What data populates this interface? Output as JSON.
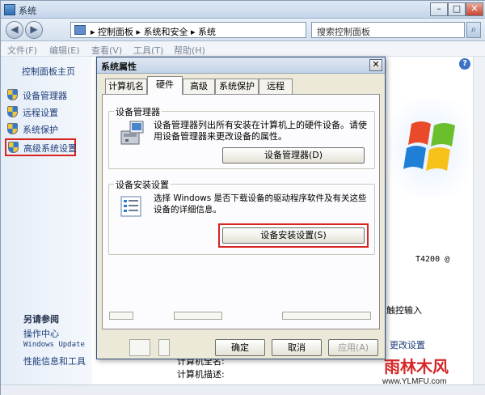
{
  "window": {
    "title": "系统",
    "min_glyph": "–",
    "max_glyph": "□",
    "close_glyph": "✕"
  },
  "address": {
    "path": "▸ 控制面板 ▸ 系统和安全 ▸ 系统",
    "dropdown_glyph": "▾",
    "refresh_glyph": "↻",
    "search_placeholder": "搜索控制面板",
    "search_glyph": "⌕",
    "back_glyph": "◀",
    "forward_glyph": "▶"
  },
  "menu": {
    "file": "文件(F)",
    "edit": "编辑(E)",
    "view": "查看(V)",
    "tools": "工具(T)",
    "help": "帮助(H)"
  },
  "left_pane": {
    "home": "控制面板主页",
    "items": [
      {
        "label": "设备管理器"
      },
      {
        "label": "远程设置"
      },
      {
        "label": "系统保护"
      },
      {
        "label": "高级系统设置"
      }
    ],
    "see_also_title": "另请参阅",
    "see_also": [
      {
        "label": "操作中心"
      },
      {
        "label": "Windows Update"
      },
      {
        "label": "性能信息和工具"
      }
    ]
  },
  "background": {
    "help_glyph": "?",
    "cpu": "T4200  @",
    "touch": "触控输入",
    "change": "更改设置",
    "computer_name": "计算机全名:",
    "computer_desc": "计算机描述:"
  },
  "dialog": {
    "title": "系统属性",
    "close_glyph": "✕",
    "tabs": [
      {
        "label": "计算机名"
      },
      {
        "label": "硬件"
      },
      {
        "label": "高级"
      },
      {
        "label": "系统保护"
      },
      {
        "label": "远程"
      }
    ],
    "device_manager": {
      "title": "设备管理器",
      "desc": "设备管理器列出所有安装在计算机上的硬件设备。请使用设备管理器来更改设备的属性。",
      "button": "设备管理器(D)"
    },
    "device_install": {
      "title": "设备安装设置",
      "desc": "选择 Windows 是否下载设备的驱动程序软件及有关这些设备的详细信息。",
      "button": "设备安装设置(S)"
    },
    "ok": "确定",
    "cancel": "取消",
    "apply": "应用(A)"
  },
  "watermark": {
    "name": "雨林木风",
    "url": "www.YLMFU.com"
  },
  "colors": {
    "highlight_red": "#d8231f",
    "link_blue": "#1e3d78",
    "dialog_face": "#ece9d8"
  }
}
